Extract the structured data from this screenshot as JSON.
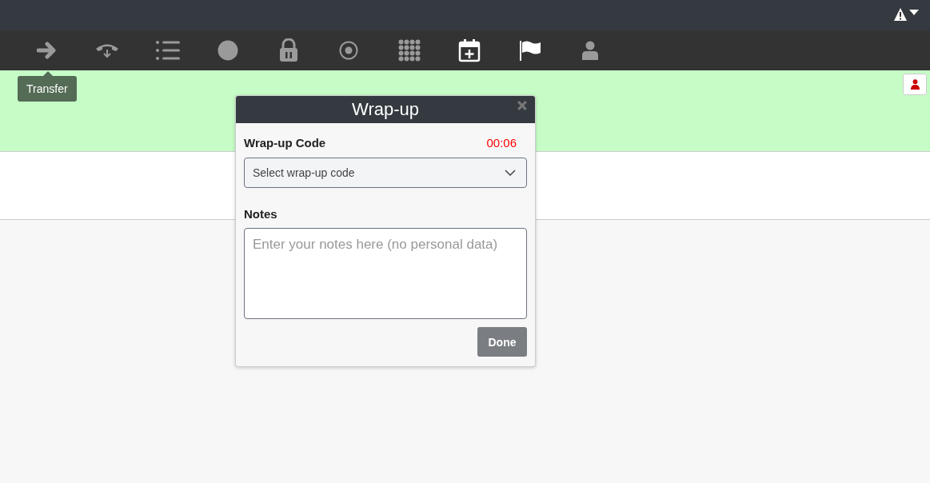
{
  "toolbar": [
    {
      "kind": "arrow",
      "bright": false
    },
    {
      "kind": "phone",
      "bright": false
    },
    {
      "kind": "list",
      "bright": false
    },
    {
      "kind": "circle",
      "bright": false
    },
    {
      "kind": "lock",
      "bright": false
    },
    {
      "kind": "record",
      "bright": false
    },
    {
      "kind": "dialpad",
      "bright": false
    },
    {
      "kind": "calendar",
      "bright": true
    },
    {
      "kind": "flag",
      "bright": true
    },
    {
      "kind": "user",
      "bright": false
    }
  ],
  "tooltip": "Transfer",
  "dialog": {
    "title": "Wrap-up",
    "code_label": "Wrap-up Code",
    "timer": "00:06",
    "select_placeholder": "Select wrap-up code",
    "notes_label": "Notes",
    "notes_placeholder": "Enter your notes here (no personal data)",
    "done": "Done"
  }
}
